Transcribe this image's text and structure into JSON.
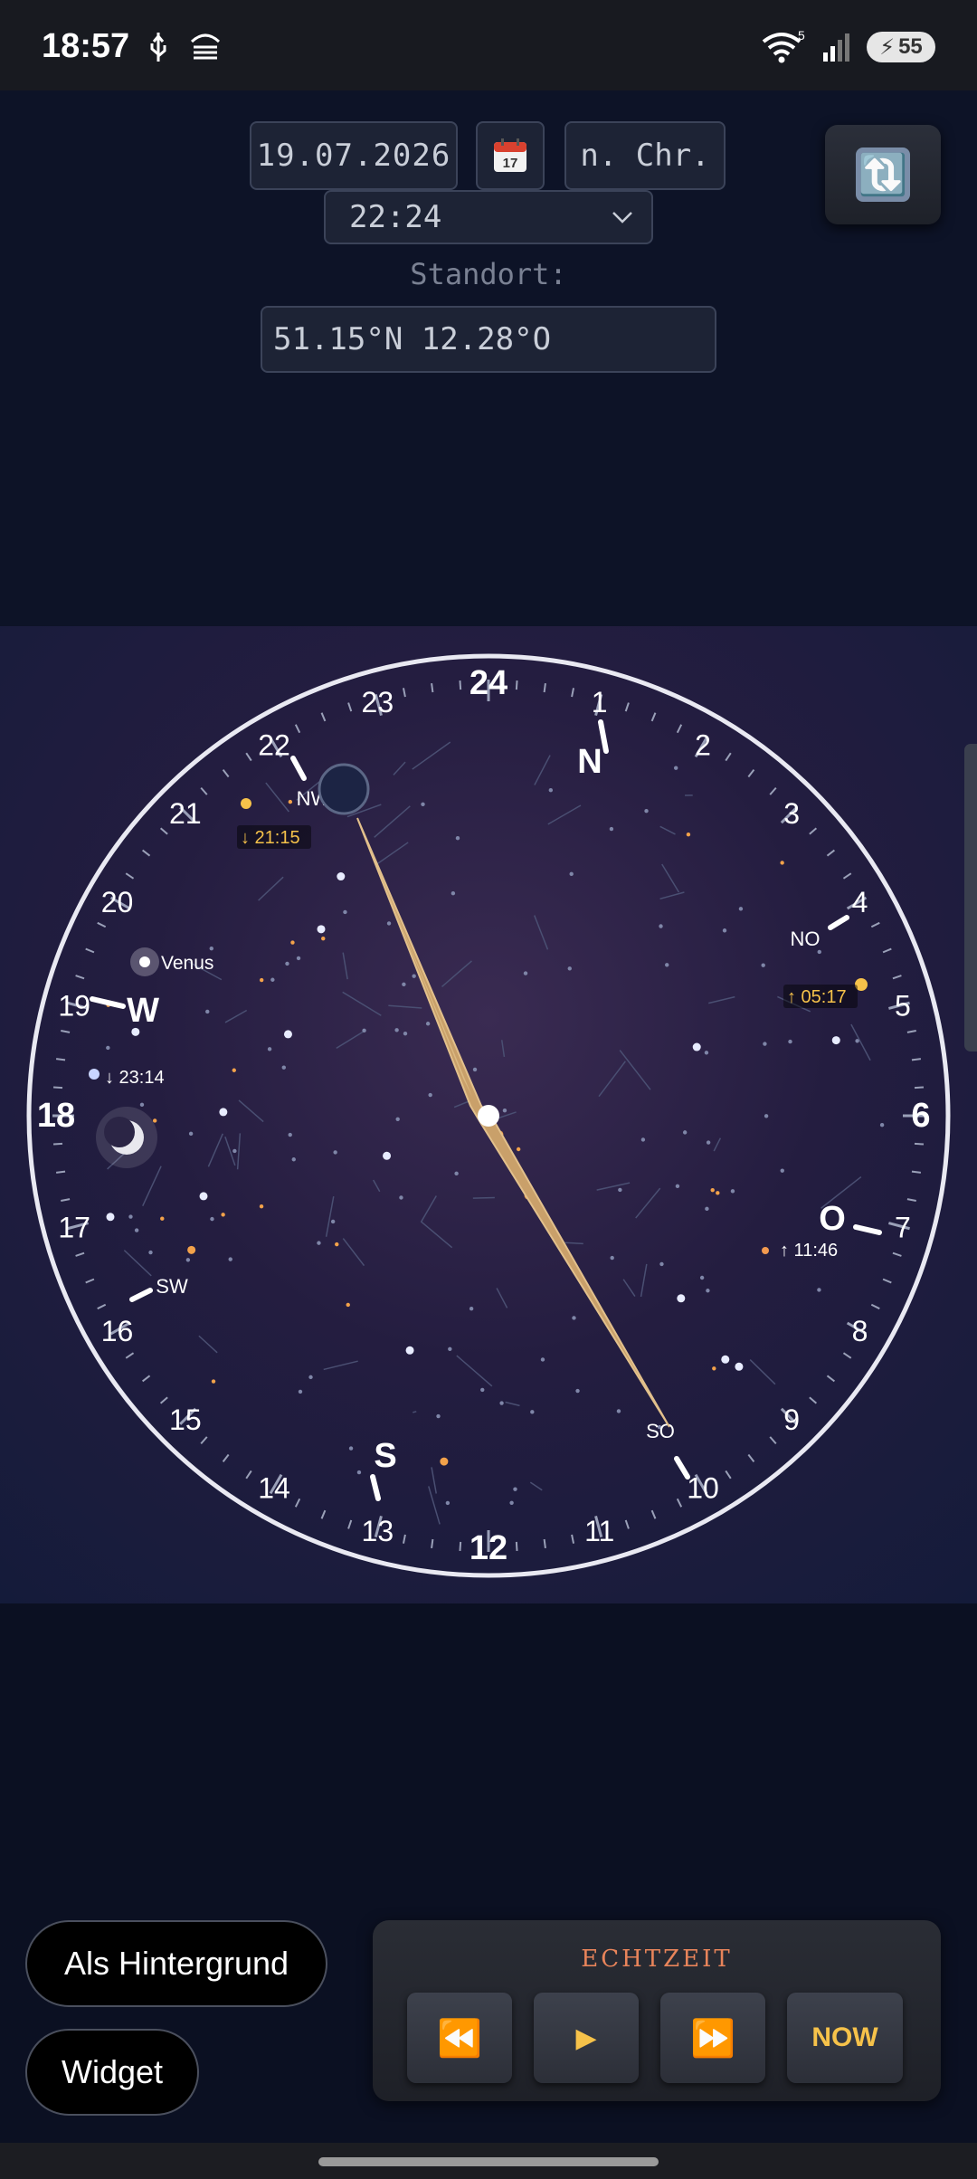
{
  "status_bar": {
    "time": "18:57",
    "left_icons": [
      "usb-icon",
      "data-saver-icon"
    ],
    "right_icons": [
      "wifi-icon",
      "signal-icon"
    ],
    "wifi_badge": "5",
    "battery": "55"
  },
  "header": {
    "date_value": "19.07.2026",
    "calendar_icon_text": "17",
    "era_value": "n. Chr.",
    "time_value": "22:24",
    "location_label": "Standort:",
    "location_value": "51.15°N 12.28°O"
  },
  "clock": {
    "hour_numbers": [
      {
        "label": "24",
        "bold": true
      },
      {
        "label": "1"
      },
      {
        "label": "2"
      },
      {
        "label": "3"
      },
      {
        "label": "4"
      },
      {
        "label": "5"
      },
      {
        "label": "6",
        "bold": true
      },
      {
        "label": "7"
      },
      {
        "label": "8"
      },
      {
        "label": "9"
      },
      {
        "label": "10"
      },
      {
        "label": "11"
      },
      {
        "label": "12",
        "bold": true
      },
      {
        "label": "13"
      },
      {
        "label": "14"
      },
      {
        "label": "15"
      },
      {
        "label": "16"
      },
      {
        "label": "17"
      },
      {
        "label": "18",
        "bold": true
      },
      {
        "label": "19"
      },
      {
        "label": "20"
      },
      {
        "label": "21"
      },
      {
        "label": "22"
      },
      {
        "label": "23"
      }
    ],
    "directions": {
      "N": "N",
      "NO": "NO",
      "O": "O",
      "SO": "SO",
      "S": "S",
      "SW": "SW",
      "W": "W",
      "NW": "NW"
    },
    "planet_label": "Venus",
    "events": {
      "set_2115": "↓ 21:15",
      "rise_0517": "↑ 05:17",
      "set_2314": "↓ 23:14",
      "rise_1146": "↑ 11:46"
    }
  },
  "bottom": {
    "wallpaper_button": "Als Hintergrund",
    "widget_button": "Widget",
    "realtime_label": "ECHTZEIT",
    "rewind_icon": "⏪",
    "play_icon": "▶",
    "forward_icon": "⏩",
    "now_button": "NOW"
  },
  "colors": {
    "accent_orange": "#e8845a",
    "accent_gold": "#f6c24a",
    "hand": "#c9a06a"
  }
}
